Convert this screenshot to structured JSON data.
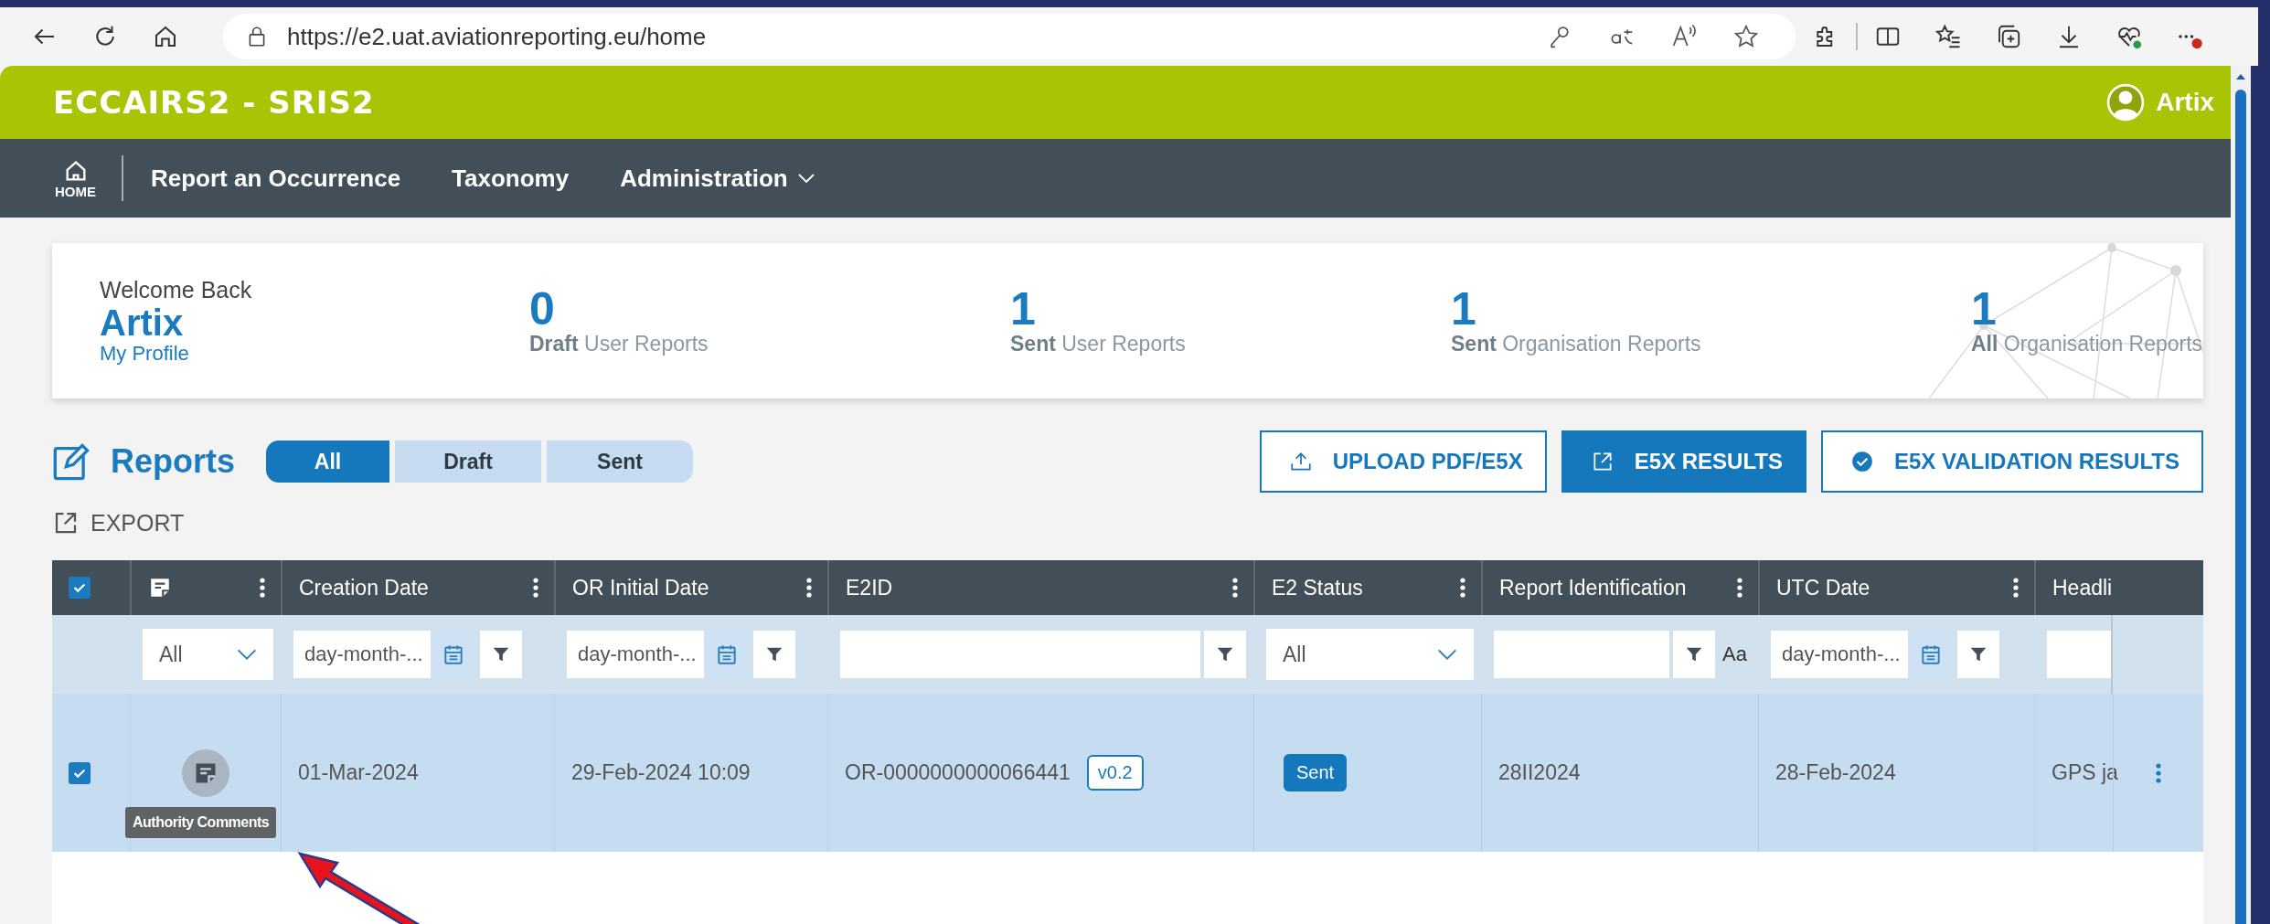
{
  "browser": {
    "url": "https://e2.uat.aviationreporting.eu/home"
  },
  "app": {
    "logo": "ECCAIRS2 - SRIS2",
    "user": "Artix"
  },
  "nav": {
    "home_label": "HOME",
    "items": [
      {
        "label": "Report an Occurrence",
        "dropdown": false
      },
      {
        "label": "Taxonomy",
        "dropdown": false
      },
      {
        "label": "Administration",
        "dropdown": true
      }
    ]
  },
  "summary": {
    "greeting": "Welcome Back",
    "name": "Artix",
    "profile_link": "My Profile",
    "stats": [
      {
        "count": "0",
        "label": "**Draft** User Reports"
      },
      {
        "count": "1",
        "label": "**Sent** User Reports"
      },
      {
        "count": "1",
        "label": "**Sent** Organisation Reports"
      },
      {
        "count": "1",
        "label": "**All** Organisation Reports"
      }
    ]
  },
  "reports": {
    "title": "Reports",
    "tabs": [
      {
        "label": "All",
        "selected": true
      },
      {
        "label": "Draft",
        "selected": false
      },
      {
        "label": "Sent",
        "selected": false
      }
    ],
    "export": "EXPORT",
    "actions": [
      {
        "label": "UPLOAD PDF/E5X",
        "kind": "upload",
        "primary": false
      },
      {
        "label": "E5X RESULTS",
        "kind": "external",
        "primary": true
      },
      {
        "label": "E5X VALIDATION RESULTS",
        "kind": "check",
        "primary": false
      }
    ]
  },
  "table": {
    "select_all_checked": true,
    "columns": [
      {
        "kind": "comment",
        "menu": true
      },
      {
        "kind": "text",
        "label": "Creation Date",
        "menu": true
      },
      {
        "kind": "text",
        "label": "OR Initial Date",
        "menu": true
      },
      {
        "kind": "text",
        "label": "E2ID",
        "menu": true
      },
      {
        "kind": "text",
        "label": "E2 Status",
        "menu": true
      },
      {
        "kind": "text",
        "label": "Report Identification",
        "menu": true
      },
      {
        "kind": "text",
        "label": "UTC Date",
        "menu": true
      },
      {
        "kind": "text",
        "label": "Headli",
        "menu": false
      }
    ],
    "filters": [
      {
        "kind": "select",
        "value": "All"
      },
      {
        "kind": "date",
        "placeholder": "day-month-..."
      },
      {
        "kind": "date",
        "placeholder": "day-month-..."
      },
      {
        "kind": "text"
      },
      {
        "kind": "select",
        "value": "All"
      },
      {
        "kind": "text_case",
        "case_label": "Aa"
      },
      {
        "kind": "date",
        "placeholder": "day-month-..."
      },
      {
        "kind": "plain"
      }
    ],
    "rows": [
      {
        "checked": true,
        "selected": true,
        "tooltip": "Authority Comments",
        "creation_date": "01-Mar-2024",
        "or_initial_date": "29-Feb-2024 10:09",
        "e2id": "OR-0000000000066441",
        "version": "v0.2",
        "status": "Sent",
        "report_identification": "28II2024",
        "utc_date": "28-Feb-2024",
        "headline": "GPS ja"
      }
    ]
  }
}
